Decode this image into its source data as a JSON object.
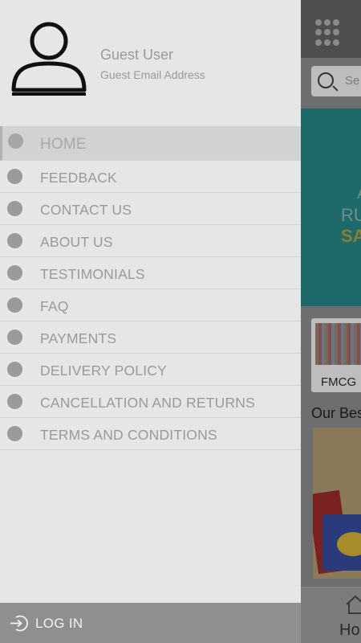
{
  "drawer": {
    "user_name": "Guest User",
    "user_email": "Guest Email Address",
    "menu_items": [
      {
        "label": "HOME",
        "active": true
      },
      {
        "label": "FEEDBACK"
      },
      {
        "label": "CONTACT US"
      },
      {
        "label": "ABOUT US"
      },
      {
        "label": "TESTIMONIALS"
      },
      {
        "label": "FAQ"
      },
      {
        "label": "PAYMENTS"
      },
      {
        "label": "DELIVERY POLICY"
      },
      {
        "label": "CANCELLATION AND RETURNS"
      },
      {
        "label": "TERMS AND CONDITIONS"
      }
    ],
    "login_label": "LOG IN"
  },
  "background": {
    "search_placeholder_visible": "Se",
    "banner_line1": "RU",
    "banner_line2": "SAV",
    "banner_top": "A",
    "category_label": "FMCG",
    "section_title": "Our Bes",
    "bottom_nav_label": "Ho"
  },
  "colors": {
    "drawer_bg": "#e6e6e6",
    "active_item_bg": "#d2d2d2",
    "login_bar_bg": "#8f8f8f",
    "banner_bg": "#1e6a6a"
  },
  "icons": [
    "avatar-icon",
    "menu-bullet-icon",
    "login-icon",
    "grid-menu-icon",
    "search-icon",
    "home-icon"
  ]
}
